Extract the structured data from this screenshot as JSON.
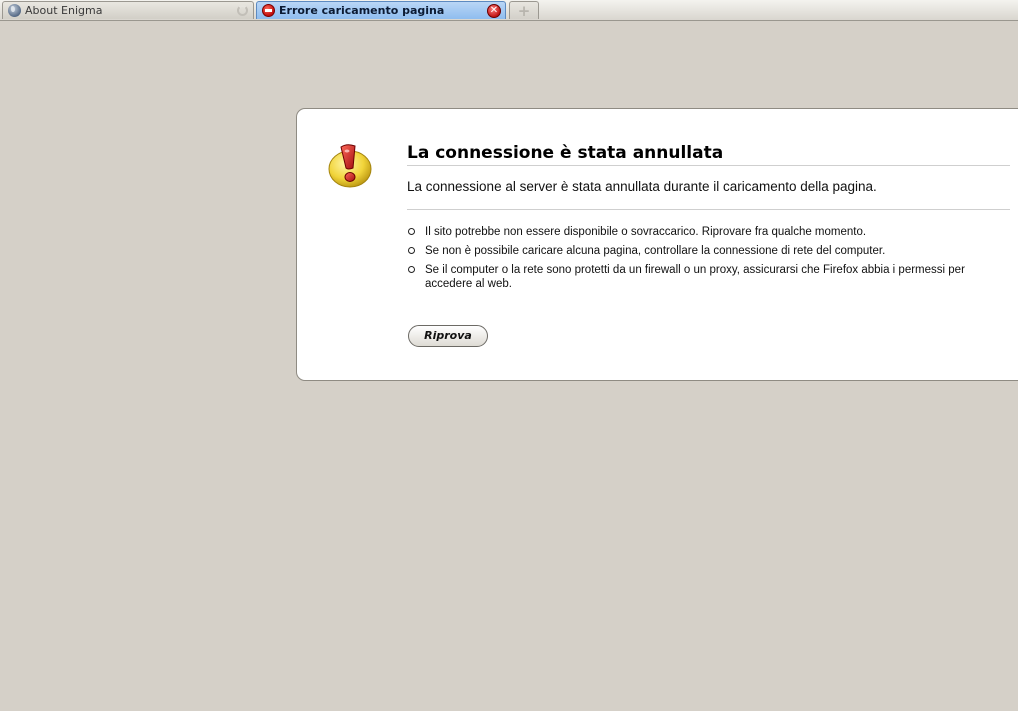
{
  "tabs": [
    {
      "label": "About Enigma",
      "icon": "globe-icon",
      "active": false
    },
    {
      "label": "Errore caricamento pagina",
      "icon": "error-icon",
      "active": true
    }
  ],
  "new_tab_symbol": "+",
  "close_symbol": "✕",
  "error_page": {
    "title": "La connessione è stata annullata",
    "subtitle": "La connessione al server è stata annullata durante il caricamento della pagina.",
    "reasons": [
      "Il sito potrebbe non essere disponibile o sovraccarico. Riprovare fra qualche momento.",
      "Se non è possibile caricare alcuna pagina, controllare la connessione di rete del computer.",
      "Se il computer o la rete sono protetti da un firewall o un proxy, assicurarsi che Firefox abbia i permessi per accedere al web."
    ],
    "retry_label": "Riprova"
  },
  "colors": {
    "page_background": "#d5d0c8",
    "active_tab": "#9fc6f1",
    "warning_yellow": "#f1d43a",
    "warning_red": "#c8171b"
  }
}
